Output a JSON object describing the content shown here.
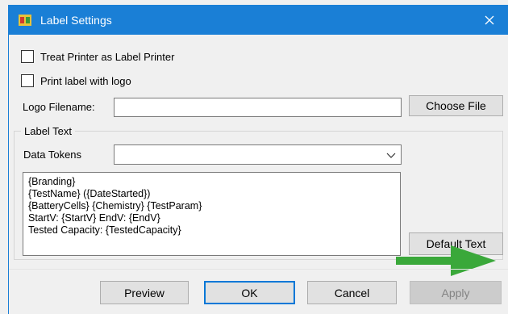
{
  "window": {
    "title": "Label Settings"
  },
  "options": {
    "treat_printer_label": "Treat Printer as Label Printer",
    "print_with_logo_label": "Print label with logo"
  },
  "logo": {
    "label": "Logo Filename:",
    "value": "",
    "choose_file_button": "Choose File"
  },
  "label_text": {
    "group_title": "Label Text",
    "data_tokens_label": "Data Tokens",
    "data_tokens_value": "",
    "lines": [
      "{Branding}",
      "{TestName} ({DateStarted})",
      "{BatteryCells} {Chemistry} {TestParam}",
      "StartV: {StartV} EndV: {EndV}",
      "Tested Capacity: {TestedCapacity}"
    ],
    "default_text_button": "Default Text"
  },
  "footer": {
    "preview_button": "Preview",
    "ok_button": "OK",
    "cancel_button": "Cancel",
    "apply_button": "Apply"
  },
  "colors": {
    "titlebar": "#1a7fd6",
    "annotation_arrow": "#3aa83a"
  },
  "icons": {
    "app": "app-icon",
    "close": "close-icon",
    "dropdown": "chevron-down-icon",
    "annotation": "arrow-right-icon"
  }
}
